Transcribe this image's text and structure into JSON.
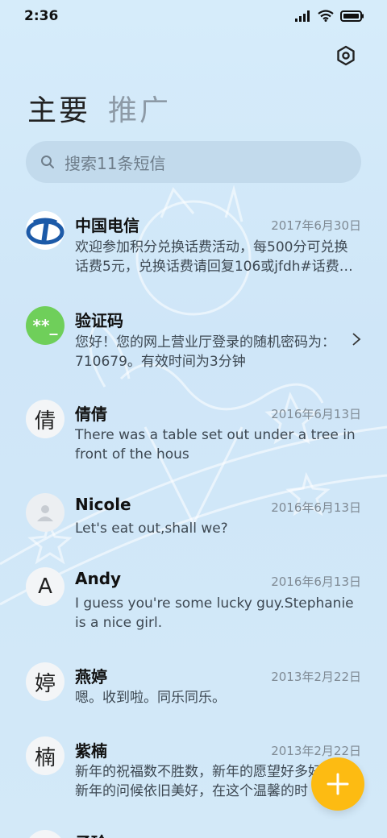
{
  "status": {
    "time": "2:36"
  },
  "tabs": [
    {
      "label": "主要"
    },
    {
      "label": "推广"
    }
  ],
  "search": {
    "placeholder": "搜索11条短信"
  },
  "conversations": [
    {
      "name": "中国电信",
      "date": "2017年6月30日",
      "preview": "欢迎参加积分兑换话费活动，每500分可兑换话费5元，兑换话费请回复106或jfdh#话费…",
      "avatar": "telecom-logo"
    },
    {
      "name": "验证码",
      "date": "",
      "preview": "您好！您的网上营业厅登录的随机密码为：710679。有效时间为3分钟",
      "avatar_text": "**_",
      "avatar_color": "#6fcf5a"
    },
    {
      "name": "倩倩",
      "date": "2016年6月13日",
      "preview": "There was a table set out under a tree in front of the hous",
      "avatar_text": "倩"
    },
    {
      "name": "Nicole",
      "date": "2016年6月13日",
      "preview": "Let's eat out,shall we?",
      "avatar": "person-icon"
    },
    {
      "name": "Andy",
      "date": "2016年6月13日",
      "preview": "I guess you're some lucky guy.Stephanie is a nice girl.",
      "avatar_text": "A"
    },
    {
      "name": "燕婷",
      "date": "2013年2月22日",
      "preview": "嗯。收到啦。同乐同乐。",
      "avatar_text": "婷"
    },
    {
      "name": "紫楠",
      "date": "2013年2月22日",
      "preview": "新年的祝福数不胜数，新年的愿望好多好多，新年的问候依旧美好，在这个温馨的时",
      "avatar_text": "楠"
    },
    {
      "name": "子玲",
      "date": "",
      "preview": "",
      "avatar_text": ""
    }
  ],
  "colors": {
    "accent_fab": "#fdbb12",
    "verification_avatar": "#6fcf5a",
    "telecom_blue": "#1c5aa8"
  }
}
